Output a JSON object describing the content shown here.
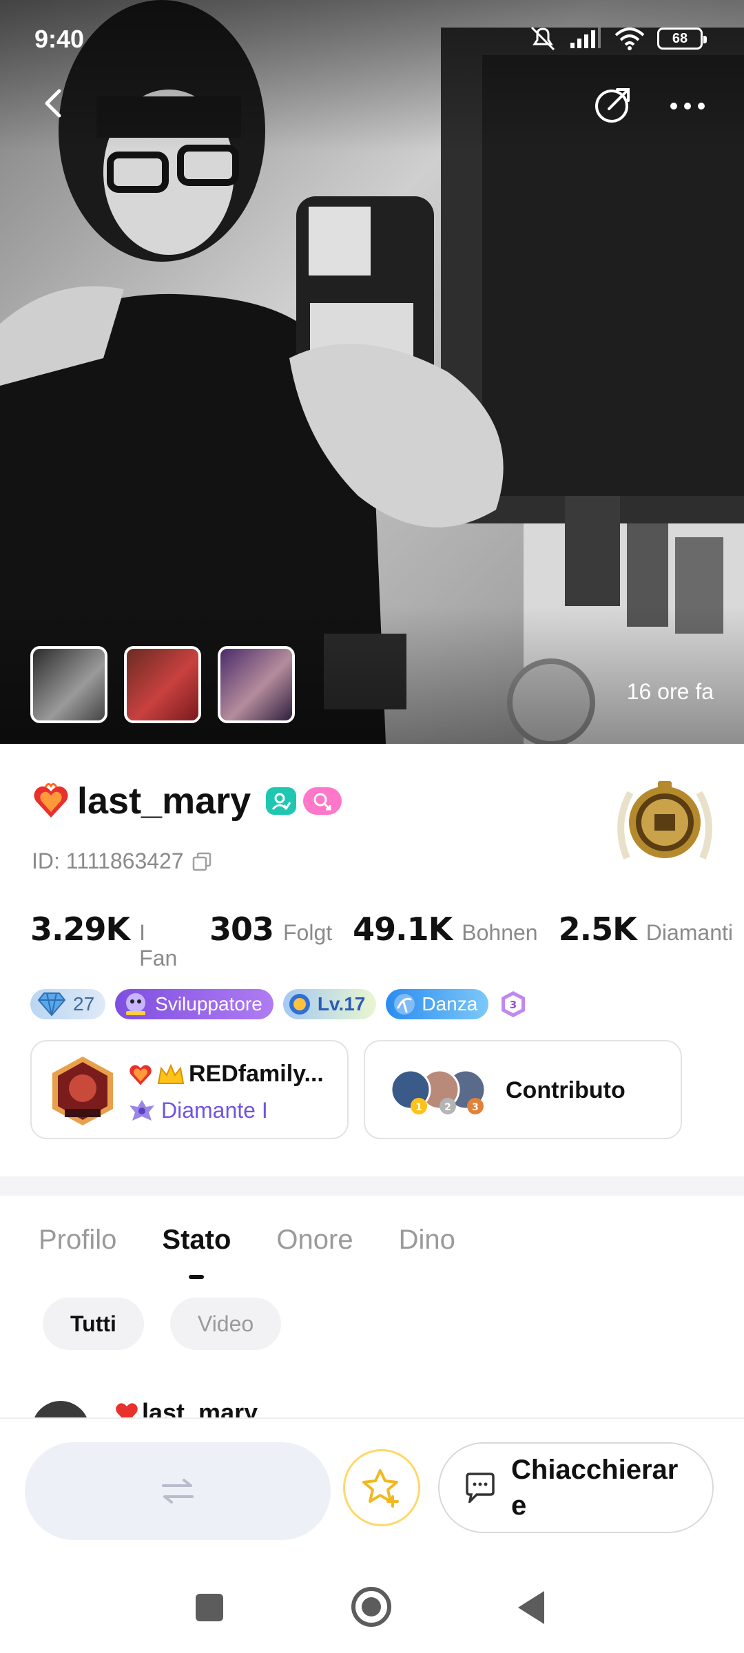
{
  "status_bar": {
    "time": "9:40",
    "battery": "68"
  },
  "hero": {
    "time_ago": "16 ore fa",
    "thumbnails": [
      "photo-1",
      "photo-2",
      "photo-3"
    ]
  },
  "profile": {
    "username": "last_mary",
    "id_text": "ID: 1111863427",
    "stats": [
      {
        "value": "3.29K",
        "label": "I Fan"
      },
      {
        "value": "303",
        "label": "Folgt"
      },
      {
        "value": "49.1K",
        "label": "Bohnen"
      },
      {
        "value": "2.5K",
        "label": "Diamanti"
      }
    ],
    "tags": {
      "diamond_level": "27",
      "developer": "Sviluppatore",
      "level": "Lv.17",
      "category": "Danza",
      "hex_level": "3"
    }
  },
  "family_card": {
    "name": "REDfamily...",
    "rank": "Diamante I"
  },
  "contribution_card": {
    "label": "Contributo",
    "ranks": [
      "1",
      "2",
      "3"
    ]
  },
  "tabs": [
    "Profilo",
    "Stato",
    "Onore",
    "Dino"
  ],
  "active_tab": "Stato",
  "filters": [
    "Tutti",
    "Video"
  ],
  "active_filter": "Tutti",
  "post_preview": {
    "author": "last_mary"
  },
  "action_bar": {
    "chat_label": "Chiacchierare"
  },
  "colors": {
    "accent_teal": "#1fc7b3",
    "accent_pink": "#ff77c9",
    "family_rank": "#6f55e0",
    "favorite_ring": "#ffd86a"
  }
}
